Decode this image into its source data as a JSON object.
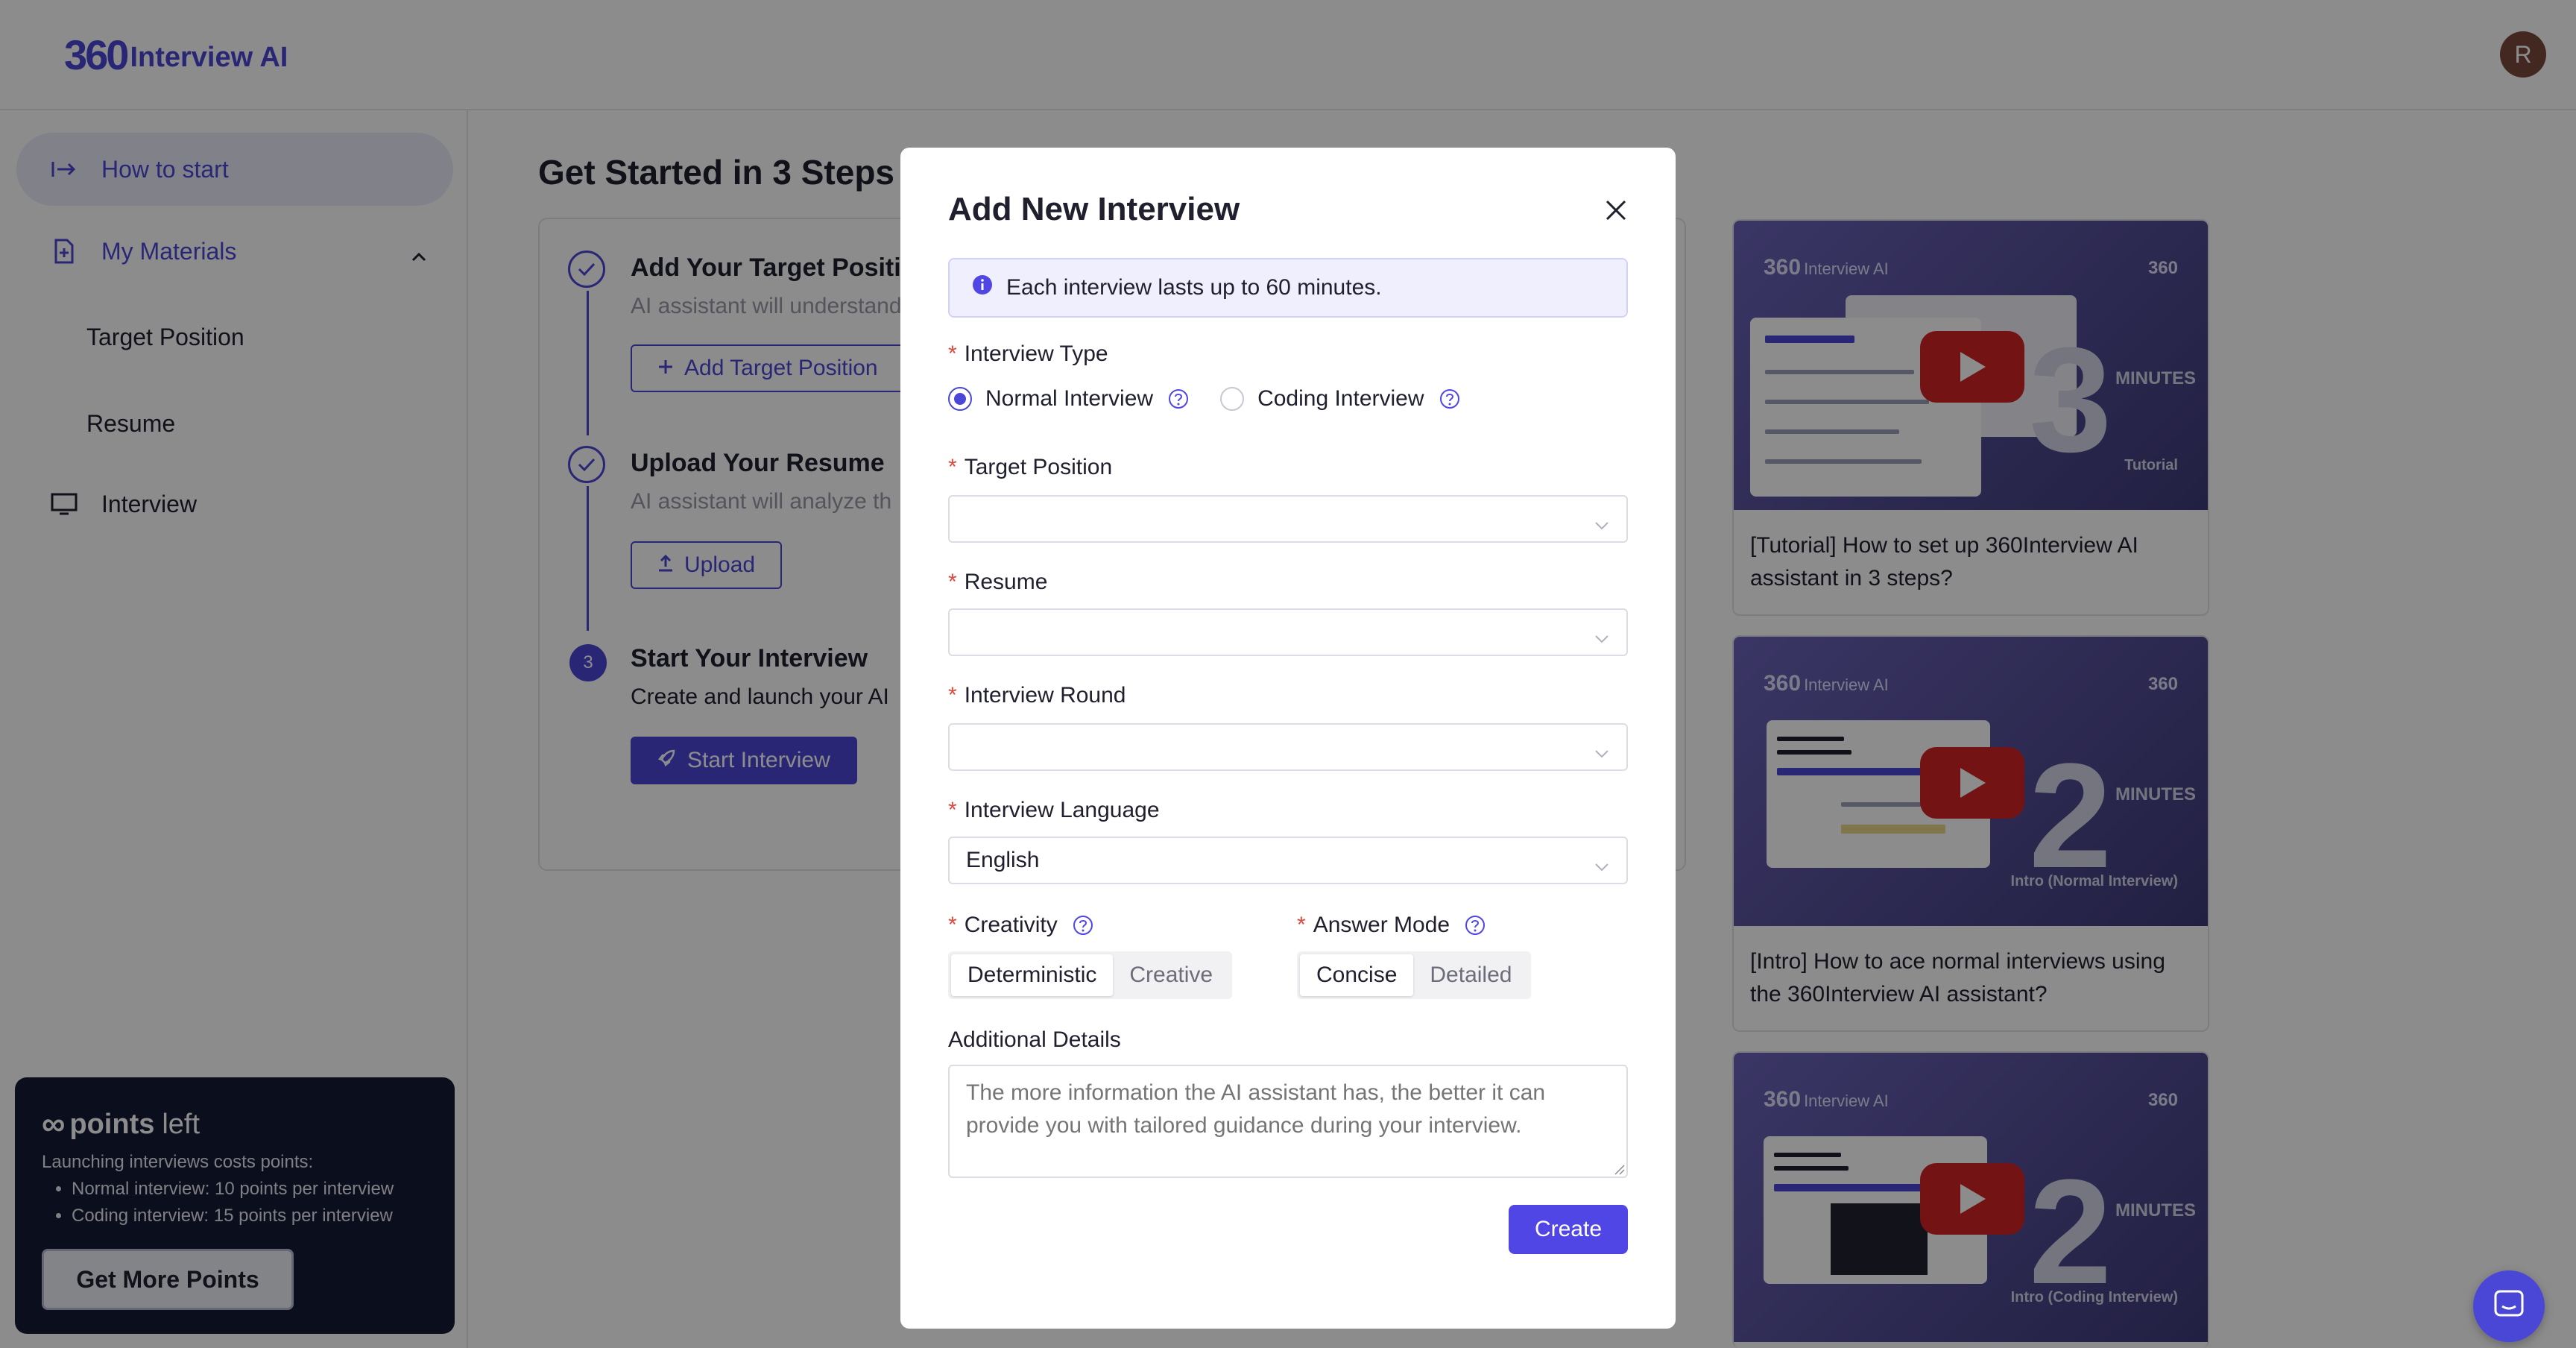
{
  "header": {
    "logo_mark": "360",
    "logo_text": "Interview AI",
    "avatar_initial": "R"
  },
  "sidebar": {
    "items": [
      {
        "label": "How to start"
      },
      {
        "label": "My Materials"
      },
      {
        "label": "Target Position"
      },
      {
        "label": "Resume"
      },
      {
        "label": "Interview"
      }
    ],
    "points": {
      "infinity": "∞",
      "bold": "points",
      "rest": "left",
      "desc": "Launching interviews costs points:",
      "list": [
        "Normal interview: 10 points per interview",
        "Coding interview: 15 points per interview"
      ],
      "button": "Get More Points"
    }
  },
  "main": {
    "title": "Get Started in 3 Steps",
    "steps": [
      {
        "title": "Add Your Target Position",
        "desc": "AI assistant will understand",
        "button": "Add Target Position"
      },
      {
        "title": "Upload Your Resume",
        "desc": "AI assistant will analyze th",
        "button": "Upload"
      },
      {
        "num": "3",
        "title": "Start Your Interview",
        "desc": "Create and launch your AI",
        "button": "Start Interview"
      }
    ]
  },
  "videos": [
    {
      "brand": "360",
      "brand_sub": "Interview AI",
      "badge": "360",
      "num": "3",
      "minutes": "MINUTES",
      "sub": "Tutorial",
      "caption": "[Tutorial] How to set up 360Interview AI assistant in 3 steps?"
    },
    {
      "brand": "360",
      "brand_sub": "Interview AI",
      "badge": "360",
      "num": "2",
      "minutes": "MINUTES",
      "sub": "Intro (Normal Interview)",
      "caption": "[Intro] How to ace normal interviews using the 360Interview AI assistant?"
    },
    {
      "brand": "360",
      "brand_sub": "Interview AI",
      "badge": "360",
      "num": "2",
      "minutes": "MINUTES",
      "sub": "Intro (Coding Interview)"
    }
  ],
  "modal": {
    "title": "Add New Interview",
    "info": "Each interview lasts up to 60 minutes.",
    "interview_type": {
      "label": "Interview Type",
      "options": [
        "Normal Interview",
        "Coding Interview"
      ],
      "selected": "Normal Interview"
    },
    "target_position": {
      "label": "Target Position",
      "value": ""
    },
    "resume": {
      "label": "Resume",
      "value": ""
    },
    "interview_round": {
      "label": "Interview Round",
      "value": ""
    },
    "interview_language": {
      "label": "Interview Language",
      "value": "English"
    },
    "creativity": {
      "label": "Creativity",
      "options": [
        "Deterministic",
        "Creative"
      ],
      "selected": "Deterministic"
    },
    "answer_mode": {
      "label": "Answer Mode",
      "options": [
        "Concise",
        "Detailed"
      ],
      "selected": "Concise"
    },
    "additional_details": {
      "label": "Additional Details",
      "placeholder": "The more information the AI assistant has, the better it can provide you with tailored guidance during your interview."
    },
    "create_button": "Create"
  },
  "colors": {
    "accent": "#4b47d6",
    "create": "#5046e5",
    "required": "#e0483c",
    "points_bg": "#151a33",
    "play": "#d42323"
  }
}
